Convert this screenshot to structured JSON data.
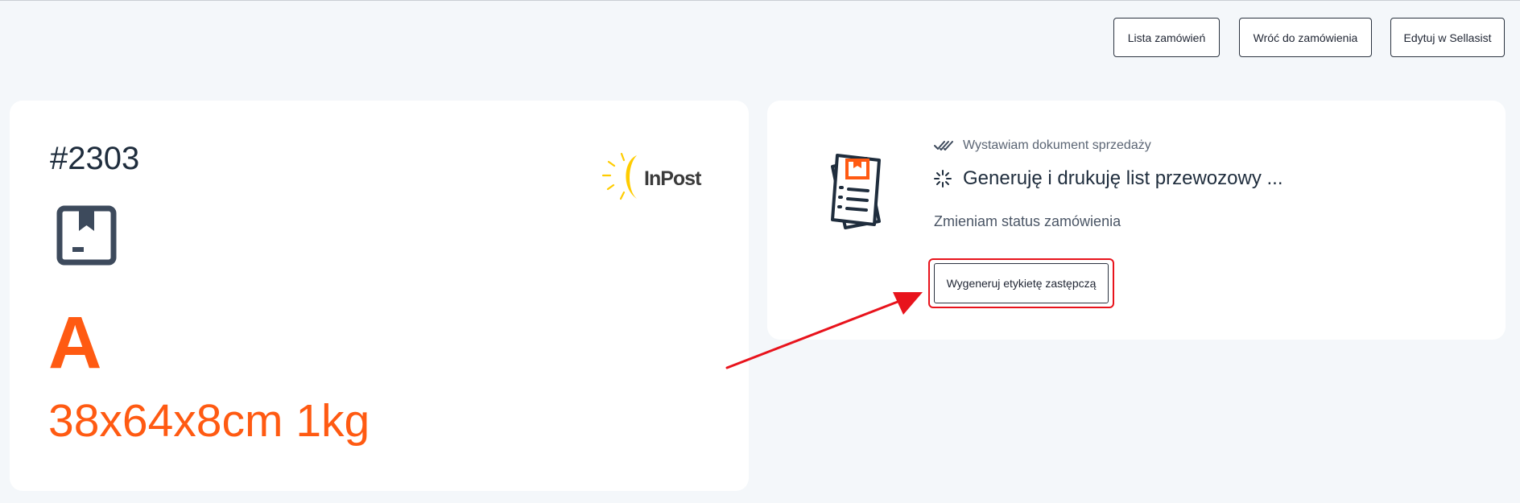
{
  "toolbar": {
    "orders_list_label": "Lista zamówień",
    "back_to_order_label": "Wróć do zamówienia",
    "edit_in_sellasist_label": "Edytuj w Sellasist"
  },
  "shipment": {
    "order_number": "#2303",
    "carrier_logo_text": "InPost",
    "size_letter": "A",
    "dimensions": "38x64x8cm 1kg"
  },
  "progress": {
    "steps": [
      {
        "label": "Wystawiam dokument sprzedaży",
        "state": "done",
        "icon": "double-check-icon"
      },
      {
        "label": "Generuję i drukuję list przewozowy ...",
        "state": "in-progress",
        "icon": "spinner-icon"
      },
      {
        "label": "Zmieniam status zamówienia",
        "state": "pending"
      }
    ],
    "alt_label_button": "Wygeneruj etykietę zastępczą"
  },
  "colors": {
    "accent": "#ff5a12",
    "highlight": "#e8131c",
    "inpost_yellow": "#ffcc00",
    "text_dark": "#1f2d3d"
  }
}
